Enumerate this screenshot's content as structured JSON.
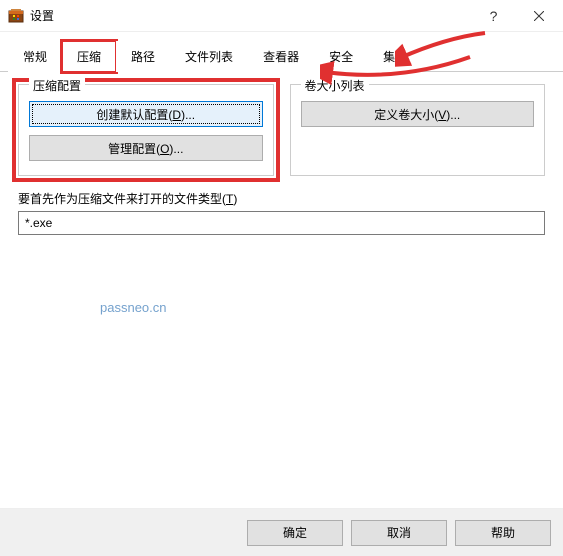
{
  "window": {
    "title": "设置"
  },
  "tabs": [
    {
      "label": "常规"
    },
    {
      "label": "压缩"
    },
    {
      "label": "路径"
    },
    {
      "label": "文件列表"
    },
    {
      "label": "查看器"
    },
    {
      "label": "安全"
    },
    {
      "label": "集成"
    }
  ],
  "compression_group": {
    "legend": "压缩配置",
    "create_default_btn_prefix": "创建默认配置(",
    "create_default_btn_key": "D",
    "create_default_btn_suffix": ")...",
    "manage_btn_prefix": "管理配置(",
    "manage_btn_key": "O",
    "manage_btn_suffix": ")..."
  },
  "volume_group": {
    "legend": "卷大小列表",
    "define_btn_prefix": "定义卷大小(",
    "define_btn_key": "V",
    "define_btn_suffix": ")..."
  },
  "file_types": {
    "label_prefix": "要首先作为压缩文件来打开的文件类型(",
    "label_key": "T",
    "label_suffix": ")",
    "value": "*.exe"
  },
  "watermark": "passneo.cn",
  "footer": {
    "ok": "确定",
    "cancel": "取消",
    "help": "帮助"
  }
}
